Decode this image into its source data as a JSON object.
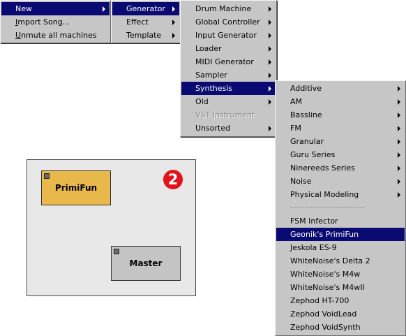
{
  "menu_main": [
    {
      "label": "New",
      "has_submenu": true,
      "selected": true
    },
    {
      "label": "Import Song...",
      "underline": "I",
      "has_submenu": false
    },
    {
      "label": "Unmute all machines",
      "underline": "U",
      "has_submenu": false
    }
  ],
  "menu_new": [
    {
      "label": "Generator",
      "has_submenu": true,
      "selected": true
    },
    {
      "label": "Effect",
      "has_submenu": true
    },
    {
      "label": "Template",
      "has_submenu": true
    }
  ],
  "menu_generator": [
    {
      "label": "Drum Machine",
      "has_submenu": true
    },
    {
      "label": "Global Controller",
      "has_submenu": true
    },
    {
      "label": "Input Generator",
      "has_submenu": true
    },
    {
      "label": "Loader",
      "has_submenu": true
    },
    {
      "label": "MIDI Generator",
      "has_submenu": true
    },
    {
      "label": "Sampler",
      "has_submenu": true
    },
    {
      "label": "Synthesis",
      "has_submenu": true,
      "selected": true
    },
    {
      "label": "Old",
      "has_submenu": true
    },
    {
      "label": "VST Instrument",
      "has_submenu": false,
      "disabled": true
    },
    {
      "label": "Unsorted",
      "has_submenu": true
    }
  ],
  "menu_synthesis": {
    "categories": [
      {
        "label": "Additive",
        "has_submenu": true
      },
      {
        "label": "AM",
        "has_submenu": true
      },
      {
        "label": "Bassline",
        "has_submenu": true
      },
      {
        "label": "FM",
        "has_submenu": true
      },
      {
        "label": "Granular",
        "has_submenu": true
      },
      {
        "label": "Guru Series",
        "has_submenu": true
      },
      {
        "label": "Ninereeds Series",
        "has_submenu": true
      },
      {
        "label": "Noise",
        "has_submenu": true
      },
      {
        "label": "Physical Modeling",
        "has_submenu": true
      }
    ],
    "separator": "------------------------------",
    "machines": [
      {
        "label": "FSM Infector"
      },
      {
        "label": "Geonik's PrimiFun",
        "selected": true
      },
      {
        "label": "Jeskola ES-9"
      },
      {
        "label": "WhiteNoise's Delta 2"
      },
      {
        "label": "WhiteNoise's M4w"
      },
      {
        "label": "WhiteNoise's M4wII"
      },
      {
        "label": "Zephod HT-700"
      },
      {
        "label": "Zephod VoidLead"
      },
      {
        "label": "Zephod VoidSynth"
      }
    ]
  },
  "machine_view": {
    "machines": [
      {
        "name": "PrimiFun",
        "color": "#e8b84a"
      },
      {
        "name": "Master",
        "color": "#c4c4c4"
      }
    ],
    "badge": "2",
    "badge_color": "#e4131b"
  },
  "colors": {
    "menu_bg": "#c6c6c6",
    "highlight_bg": "#0a0a73",
    "highlight_fg": "#ffffff",
    "disabled_fg": "#8a8a8a",
    "canvas_bg": "#e8e8e8"
  }
}
